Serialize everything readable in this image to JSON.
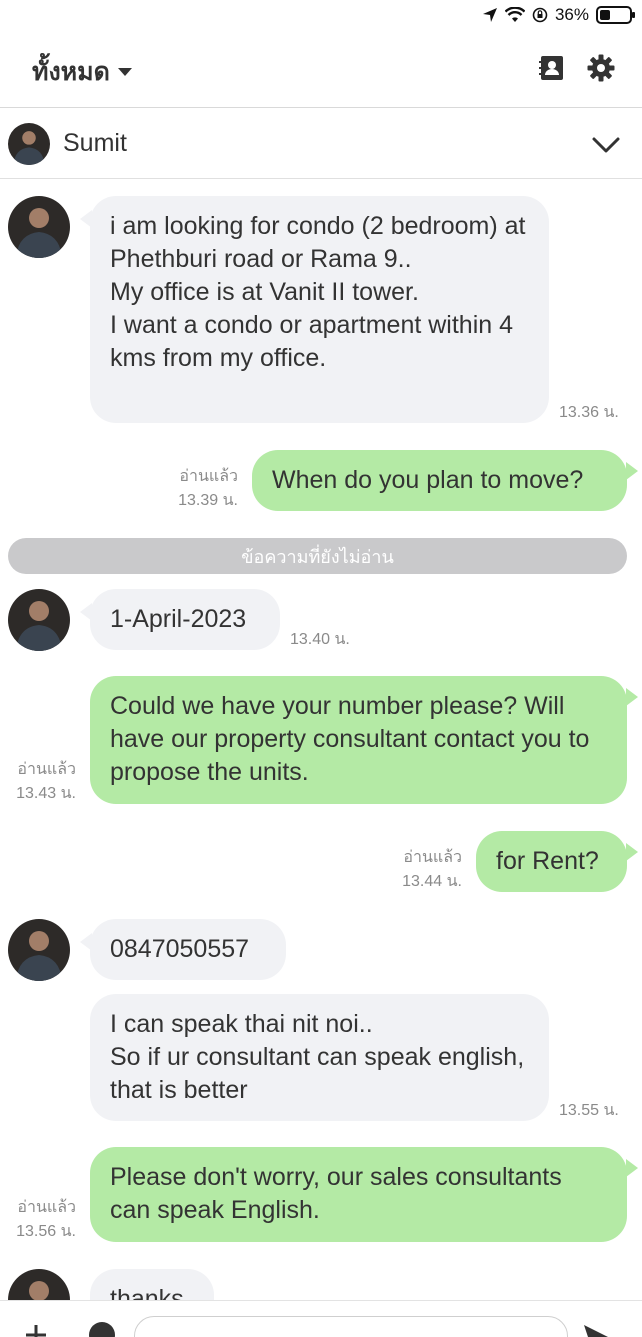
{
  "status_bar": {
    "battery": "36%",
    "battery_level": 0.36
  },
  "header": {
    "filter_label": "ทั้งหมด",
    "icons": [
      "contacts-icon",
      "settings-icon"
    ]
  },
  "contact": {
    "name": "Sumit"
  },
  "messages": [
    {
      "text": "i am looking for condo (2 bedroom) at Phethburi road or Rama 9..\nMy office is at Vanit II tower.\nI want a condo or apartment within 4 kms from my office.",
      "time": "13.36 น."
    },
    {
      "text": "When do you plan to move?",
      "read": "อ่านแล้ว",
      "time": "13.39 น."
    },
    {
      "text": "1-April-2023",
      "time": "13.40 น."
    },
    {
      "text": "Could we have your number please? Will have our property consultant contact you to propose the units.",
      "read": "อ่านแล้ว",
      "time": "13.43 น."
    },
    {
      "text": "for Rent?",
      "read": "อ่านแล้ว",
      "time": "13.44 น."
    },
    {
      "text": "0847050557"
    },
    {
      "text": "I can speak thai nit noi..\nSo if ur consultant can speak english, that is better",
      "time": "13.55 น."
    },
    {
      "text": "Please don't worry, our sales consultants can speak English.",
      "read": "อ่านแล้ว",
      "time": "13.56 น."
    },
    {
      "text": "thanks"
    }
  ],
  "unread_divider": "ข้อความที่ยังไม่อ่าน",
  "colors": {
    "outgoing_bubble": "#b4eaa5",
    "incoming_bubble": "#f1f2f5",
    "divider": "#c9c9cb"
  }
}
